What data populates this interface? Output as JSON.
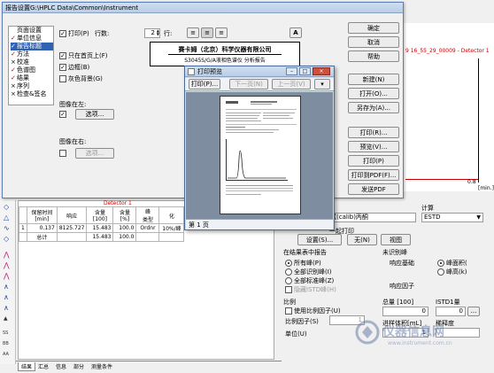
{
  "report_dialog": {
    "title": "报告设置G:\\HPLC Data\\Common\\Instrument",
    "tree_items": [
      {
        "mark": "",
        "label": "页面设置"
      },
      {
        "mark": "✓",
        "label": "单位信息"
      },
      {
        "mark": "✓",
        "label": "报告标题"
      },
      {
        "mark": "✓",
        "label": "方法"
      },
      {
        "mark": "×",
        "label": "校准"
      },
      {
        "mark": "✓",
        "label": "色谱图"
      },
      {
        "mark": "✓",
        "label": "结果"
      },
      {
        "mark": "×",
        "label": "序列"
      },
      {
        "mark": "×",
        "label": "检查&签名"
      }
    ],
    "print_label": "打印(P)",
    "rows_label": "行数:",
    "rows_value": "2",
    "row_label": "行:",
    "font_btn": "A",
    "first_page_only": "只在首页上(F)",
    "border_label": "边框(B)",
    "gray_bg_label": "灰色背景(G)",
    "image_left_label": "图像在左:",
    "image_right_label": "图像在右:",
    "choose_btn": "选项...",
    "choose_btn2": "选项...",
    "company_name": "赛卡姆（北京）科学仪器有限公司",
    "report_subtitle": "S3045S/G/A液相色谱仪  分析报告",
    "side_buttons": {
      "ok": "确定",
      "cancel": "取消",
      "help": "帮助",
      "new": "新建(N)",
      "open": "打开(O)...",
      "save_as": "另存为(A)...",
      "print": "打印(R)...",
      "preview": "预览(V)...",
      "print_a": "打印(P)",
      "print_pdf": "打印到PDF(F)...",
      "send_pdf": "发送PDF"
    }
  },
  "preview_window": {
    "title": "打印预览",
    "print_btn": "打印(P)...",
    "next_btn": "下一页(N)",
    "prev_btn": "上一页(V)",
    "page_status": "第 1 页"
  },
  "background": {
    "chart_title_fragment": "9 16_55_29_00009 - Detector 1",
    "axis_tick_08": "0.8",
    "axis_unit": "[min.]",
    "results_table": {
      "headers": [
        "保留时间\n[min]",
        "响应",
        "含量\n[100]",
        "含量\n[%]",
        "峰\n类型",
        "化"
      ],
      "rows": [
        [
          "1",
          "0.137",
          "8125.727",
          "15.483",
          "100.0",
          "Ordnr",
          "10%/峰"
        ],
        [
          "",
          "总计",
          "",
          "15.483",
          "100.0",
          "",
          ""
        ]
      ]
    },
    "detector_label": "Detector 1",
    "calc_label": "计算",
    "calc_value": "ESTD",
    "calib_field": "试(calib)丙酮",
    "print_together": "一起打印",
    "settings_btn": "设置(S)...",
    "none_btn": "无(N)",
    "view_btn": "视图",
    "report_in_results": "在结果表中报告",
    "unidentified_peaks": "未识别峰",
    "radio_all_peaks": "所有峰(P)",
    "radio_all_identified": "全部识别峰(I)",
    "radio_all_standard": "全部标准峰(Z)",
    "hide_istd": "隐藏ISTD峰(H)",
    "response_basis": "响应基础",
    "peak_area": "峰面积(",
    "peak_height": "峰高(k)",
    "response_factor": "响应因子",
    "ratio_section": "比例",
    "use_ratio": "使用比例因子(U)",
    "ratio_factor": "比例因子(S)",
    "ratio_value": "1",
    "unit_label": "单位(U)",
    "total_label": "总量 [100]",
    "total_value": "0",
    "istd1_label": "ISTD1量",
    "istd1_value": "0",
    "inject_label": "进样体积[mL]",
    "inject_value": "1",
    "dilution_label": "稀释度",
    "bottom_tabs": [
      "结果",
      "汇总",
      "信息",
      "部分",
      "测量条件"
    ],
    "watermark": "仪器信息网",
    "watermark_url": "www.instrument.com.cn"
  }
}
